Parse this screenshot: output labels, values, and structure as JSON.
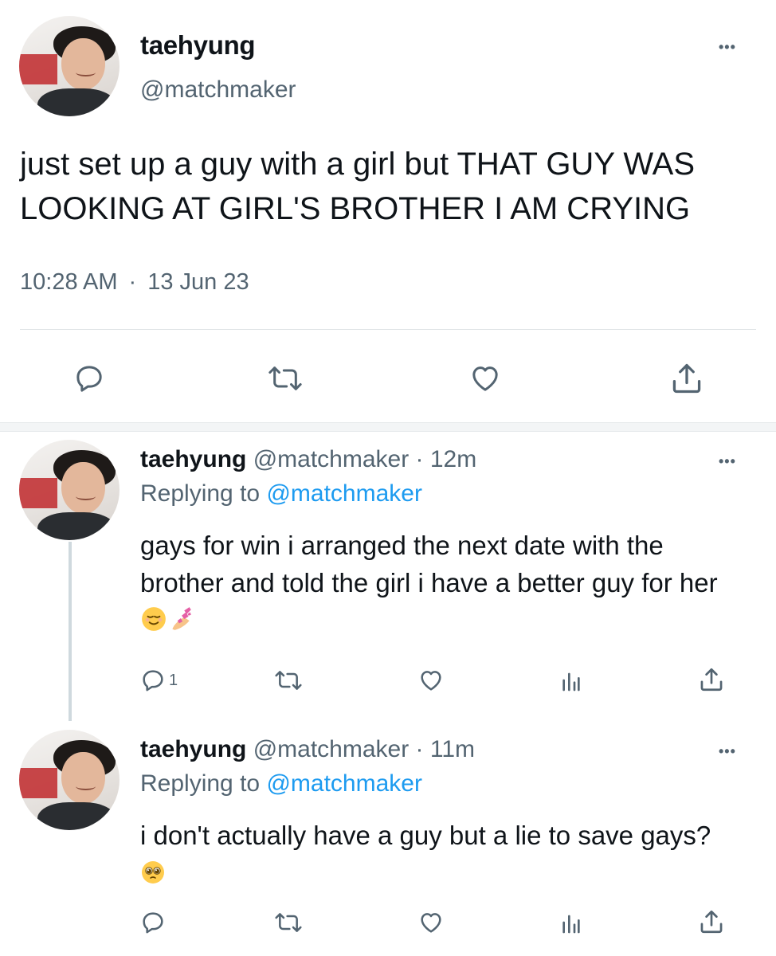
{
  "main_tweet": {
    "display_name": "taehyung",
    "handle": "@matchmaker",
    "text": "just set up a guy with a girl but THAT GUY WAS LOOKING AT GIRL'S BROTHER I AM CRYING",
    "time": "10:28 AM",
    "separator": "·",
    "date": "13 Jun 23",
    "more_label": "•••",
    "actions": [
      "reply-icon",
      "retweet-icon",
      "like-icon",
      "share-icon"
    ]
  },
  "replies": [
    {
      "display_name": "taehyung",
      "handle": "@matchmaker",
      "time": "· 12m",
      "replying_label": "Replying to",
      "replying_to": "@matchmaker",
      "text": "gays for win i arranged the next date with the brother and told the girl i have a better guy for her",
      "emojis": [
        "relieved-face-emoji",
        "nail-polish-emoji"
      ],
      "reply_count": "1",
      "more_label": "•••"
    },
    {
      "display_name": "taehyung",
      "handle": "@matchmaker",
      "time": "· 11m",
      "replying_label": "Replying to",
      "replying_to": "@matchmaker",
      "text": "i don't actually have a guy but a lie to save gays?",
      "emojis": [
        "pleading-face-emoji"
      ],
      "reply_count": "",
      "more_label": "•••"
    }
  ],
  "colors": {
    "text": "#0f1419",
    "secondary": "#536471",
    "link": "#1d9bf0",
    "divider": "#dfe3e6"
  }
}
